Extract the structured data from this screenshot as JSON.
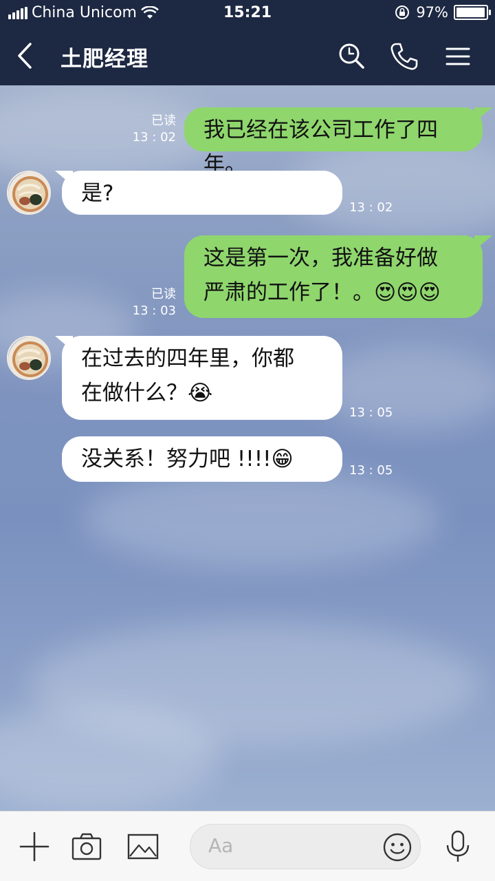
{
  "status_bar": {
    "carrier": "China Unicom",
    "time": "15:21",
    "battery_percent": "97%",
    "battery_level": 0.97,
    "icons": [
      "signal-icon",
      "wifi-icon",
      "rotation-lock-icon",
      "battery-icon"
    ]
  },
  "header": {
    "title": "土肥经理",
    "icons": [
      "back-icon",
      "search-icon",
      "phone-icon",
      "menu-icon"
    ]
  },
  "messages": [
    {
      "direction": "outgoing",
      "text": "我已经在该公司工作了四年。",
      "read_label": "已读",
      "time": "13 : 02"
    },
    {
      "direction": "incoming",
      "text": "是?",
      "time": "13 : 02"
    },
    {
      "direction": "outgoing",
      "lines": [
        "这是第一次，我准备好做",
        "严肃的工作了！。😍😍😍"
      ],
      "read_label": "已读",
      "time": "13 : 03"
    },
    {
      "direction": "incoming",
      "lines": [
        "在过去的四年里，你都",
        "在做什么？😭"
      ],
      "time": "13 : 05"
    },
    {
      "direction": "incoming",
      "text": "没关系！努力吧 !!!!😁",
      "time": "13 : 05"
    }
  ],
  "input_bar": {
    "placeholder": "Aa",
    "icons": [
      "plus-icon",
      "camera-icon",
      "image-icon",
      "emoji-icon",
      "microphone-icon"
    ]
  },
  "colors": {
    "header_bg": "#1d2842",
    "outgoing_bubble": "#8fd66d",
    "incoming_bubble": "#ffffff",
    "chat_background": "#7d93bd"
  }
}
